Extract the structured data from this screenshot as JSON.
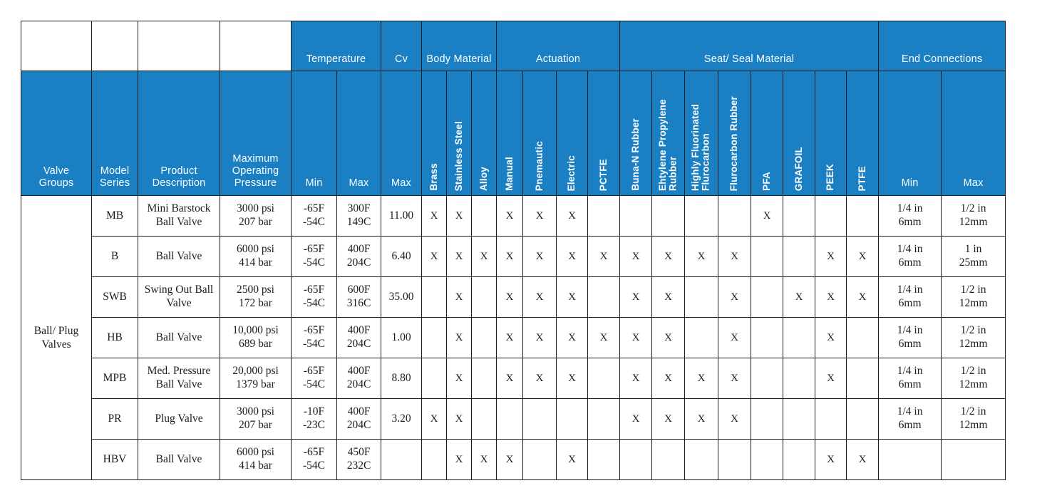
{
  "table": {
    "header_groups": [
      {
        "label": "Temperature",
        "span": 2
      },
      {
        "label": "Cv",
        "span": 1
      },
      {
        "label": "Body Material",
        "span": 3
      },
      {
        "label": "Actuation",
        "span": 4
      },
      {
        "label": "Seat/ Seal Material",
        "span": 8
      },
      {
        "label": "End Connections",
        "span": 2
      }
    ],
    "stub_headers": [
      {
        "label": "Valve Groups",
        "lines": [
          "Valve",
          "Groups"
        ]
      },
      {
        "label": "Model Series",
        "lines": [
          "Model",
          "Series"
        ]
      },
      {
        "label": "Product Description",
        "lines": [
          "Product",
          "Description"
        ]
      },
      {
        "label": "Maximum Operating Pressure",
        "lines": [
          "Maximum",
          "Operating",
          "Pressure"
        ]
      }
    ],
    "sub_headers": {
      "temperature_min": "Min",
      "temperature_max": "Max",
      "cv_max": "Max",
      "end_min": "Min",
      "end_max": "Max"
    },
    "vertical_headers": {
      "brass": "Brass",
      "stainless_steel": "Stainless Steel",
      "alloy": "Alloy",
      "manual": "Manual",
      "pneumatic": "Pnemautic",
      "electric": "Electric",
      "pctfe": "PCTFE",
      "buna_n_rubber": "Buna-N Rubber",
      "ethylene_propylene_rubber": "Ehtylene Propylene Rubber",
      "highly_fluorinated_flurocarbon": "Highly Fluorinated Flurocarbon",
      "flurocarbon_rubber": "Flurocarbon Rubber",
      "pfa": "PFA",
      "grafoil": "GRAFOIL",
      "peek": "PEEK",
      "ptfe": "PTFE"
    },
    "group_cell": {
      "lines": [
        "Ball/ Plug",
        "Valves"
      ],
      "rowspan": 7
    },
    "mark": "X",
    "rows": [
      {
        "model_series": "MB",
        "product_description": [
          "Mini Barstock",
          "Ball Valve"
        ],
        "max_operating_pressure": [
          "3000 psi",
          "207 bar"
        ],
        "temp_min": [
          "-65F",
          "-54C"
        ],
        "temp_max": [
          "300F",
          "149C"
        ],
        "cv_max": "11.00",
        "brass": "X",
        "stainless_steel": "X",
        "alloy": "",
        "manual": "X",
        "pneumatic": "X",
        "electric": "X",
        "pctfe": "",
        "buna_n_rubber": "",
        "ethylene_propylene_rubber": "",
        "highly_fluorinated_flurocarbon": "",
        "flurocarbon_rubber": "",
        "pfa": "X",
        "grafoil": "",
        "peek": "",
        "ptfe": "",
        "end_min": [
          "1/4 in",
          "6mm"
        ],
        "end_max": [
          "1/2 in",
          "12mm"
        ]
      },
      {
        "model_series": "B",
        "product_description": [
          "Ball Valve"
        ],
        "max_operating_pressure": [
          "6000 psi",
          "414 bar"
        ],
        "temp_min": [
          "-65F",
          "-54C"
        ],
        "temp_max": [
          "400F",
          "204C"
        ],
        "cv_max": "6.40",
        "brass": "X",
        "stainless_steel": "X",
        "alloy": "X",
        "manual": "X",
        "pneumatic": "X",
        "electric": "X",
        "pctfe": "X",
        "buna_n_rubber": "X",
        "ethylene_propylene_rubber": "X",
        "highly_fluorinated_flurocarbon": "X",
        "flurocarbon_rubber": "X",
        "pfa": "",
        "grafoil": "",
        "peek": "X",
        "ptfe": "X",
        "end_min": [
          "1/4 in",
          "6mm"
        ],
        "end_max": [
          "1 in",
          "25mm"
        ]
      },
      {
        "model_series": "SWB",
        "product_description": [
          "Swing Out Ball",
          "Valve"
        ],
        "max_operating_pressure": [
          "2500 psi",
          "172 bar"
        ],
        "temp_min": [
          "-65F",
          "-54C"
        ],
        "temp_max": [
          "600F",
          "316C"
        ],
        "cv_max": "35.00",
        "brass": "",
        "stainless_steel": "X",
        "alloy": "",
        "manual": "X",
        "pneumatic": "X",
        "electric": "X",
        "pctfe": "",
        "buna_n_rubber": "X",
        "ethylene_propylene_rubber": "X",
        "highly_fluorinated_flurocarbon": "",
        "flurocarbon_rubber": "X",
        "pfa": "",
        "grafoil": "X",
        "peek": "X",
        "ptfe": "X",
        "end_min": [
          "1/4 in",
          "6mm"
        ],
        "end_max": [
          "1/2 in",
          "12mm"
        ]
      },
      {
        "model_series": "HB",
        "product_description": [
          "Ball Valve"
        ],
        "max_operating_pressure": [
          "10,000 psi",
          "689 bar"
        ],
        "temp_min": [
          "-65F",
          "-54C"
        ],
        "temp_max": [
          "400F",
          "204C"
        ],
        "cv_max": "1.00",
        "brass": "",
        "stainless_steel": "X",
        "alloy": "",
        "manual": "X",
        "pneumatic": "X",
        "electric": "X",
        "pctfe": "X",
        "buna_n_rubber": "X",
        "ethylene_propylene_rubber": "X",
        "highly_fluorinated_flurocarbon": "",
        "flurocarbon_rubber": "X",
        "pfa": "",
        "grafoil": "",
        "peek": "X",
        "ptfe": "",
        "end_min": [
          "1/4 in",
          "6mm"
        ],
        "end_max": [
          "1/2 in",
          "12mm"
        ]
      },
      {
        "model_series": "MPB",
        "product_description": [
          "Med. Pressure",
          "Ball Valve"
        ],
        "max_operating_pressure": [
          "20,000 psi",
          "1379 bar"
        ],
        "temp_min": [
          "-65F",
          "-54C"
        ],
        "temp_max": [
          "400F",
          "204C"
        ],
        "cv_max": "8.80",
        "brass": "",
        "stainless_steel": "X",
        "alloy": "",
        "manual": "X",
        "pneumatic": "X",
        "electric": "X",
        "pctfe": "",
        "buna_n_rubber": "X",
        "ethylene_propylene_rubber": "X",
        "highly_fluorinated_flurocarbon": "X",
        "flurocarbon_rubber": "X",
        "pfa": "",
        "grafoil": "",
        "peek": "X",
        "ptfe": "",
        "end_min": [
          "1/4 in",
          "6mm"
        ],
        "end_max": [
          "1/2 in",
          "12mm"
        ]
      },
      {
        "model_series": "PR",
        "product_description": [
          "Plug Valve"
        ],
        "max_operating_pressure": [
          "3000 psi",
          "207 bar"
        ],
        "temp_min": [
          "-10F",
          "-23C"
        ],
        "temp_max": [
          "400F",
          "204C"
        ],
        "cv_max": "3.20",
        "brass": "X",
        "stainless_steel": "X",
        "alloy": "",
        "manual": "",
        "pneumatic": "",
        "electric": "",
        "pctfe": "",
        "buna_n_rubber": "X",
        "ethylene_propylene_rubber": "X",
        "highly_fluorinated_flurocarbon": "X",
        "flurocarbon_rubber": "X",
        "pfa": "",
        "grafoil": "",
        "peek": "",
        "ptfe": "",
        "end_min": [
          "1/4 in",
          "6mm"
        ],
        "end_max": [
          "1/2 in",
          "12mm"
        ]
      },
      {
        "model_series": "HBV",
        "product_description": [
          "Ball Valve"
        ],
        "max_operating_pressure": [
          "6000 psi",
          "414 bar"
        ],
        "temp_min": [
          "-65F",
          "-54C"
        ],
        "temp_max": [
          "450F",
          "232C"
        ],
        "cv_max": "",
        "brass": "",
        "stainless_steel": "X",
        "alloy": "X",
        "manual": "X",
        "pneumatic": "",
        "electric": "X",
        "pctfe": "",
        "buna_n_rubber": "",
        "ethylene_propylene_rubber": "",
        "highly_fluorinated_flurocarbon": "",
        "flurocarbon_rubber": "",
        "pfa": "",
        "grafoil": "",
        "peek": "X",
        "ptfe": "X",
        "end_min": [],
        "end_max": []
      }
    ]
  },
  "colors": {
    "header_blue": "#1b7fc4",
    "header_text": "#ffffff",
    "grid_line": "#1a1a1a",
    "body_text": "#1c1c1c",
    "page_background": "#ffffff"
  }
}
